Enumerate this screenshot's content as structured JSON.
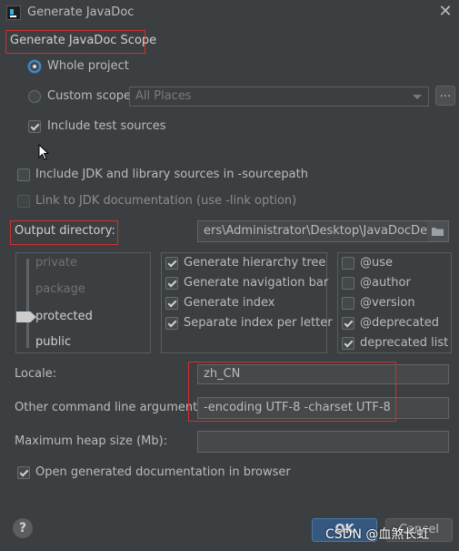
{
  "window": {
    "title": "Generate JavaDoc"
  },
  "scope": {
    "heading": "Generate JavaDoc Scope",
    "whole_project": "Whole project",
    "custom_scope": "Custom scope",
    "custom_scope_value": "All Places",
    "browse_label": "...",
    "include_test_sources": "Include test sources"
  },
  "options": {
    "include_jdk": "Include JDK and library sources in -sourcepath",
    "link_jdk": "Link to JDK documentation (use -link option)"
  },
  "output": {
    "label": "Output directory:",
    "value": "ers\\Administrator\\Desktop\\JavaDocDemo"
  },
  "visibility": {
    "levels": [
      "private",
      "package",
      "protected",
      "public"
    ],
    "selected": "protected"
  },
  "generate": {
    "items": [
      {
        "label": "Generate hierarchy tree",
        "checked": true
      },
      {
        "label": "Generate navigation bar",
        "checked": true
      },
      {
        "label": "Generate index",
        "checked": true
      },
      {
        "label": "Separate index per letter",
        "checked": true
      }
    ]
  },
  "tags": {
    "items": [
      {
        "label": "@use",
        "checked": false
      },
      {
        "label": "@author",
        "checked": false
      },
      {
        "label": "@version",
        "checked": false
      },
      {
        "label": "@deprecated",
        "checked": true
      },
      {
        "label": "deprecated list",
        "checked": true
      }
    ]
  },
  "locale": {
    "label": "Locale:",
    "value": "zh_CN"
  },
  "args": {
    "label": "Other command line arguments:",
    "value": "-encoding UTF-8 -charset UTF-8"
  },
  "heap": {
    "label": "Maximum heap size (Mb):",
    "value": ""
  },
  "open_browser": {
    "label": "Open generated documentation in browser",
    "checked": true
  },
  "footer": {
    "help": "?",
    "ok": "OK",
    "cancel": "Cancel",
    "watermark": "CSDN @血煞长虹"
  },
  "colors": {
    "accent": "#365880",
    "highlight": "#d32f2f",
    "background": "#3c3f41"
  }
}
